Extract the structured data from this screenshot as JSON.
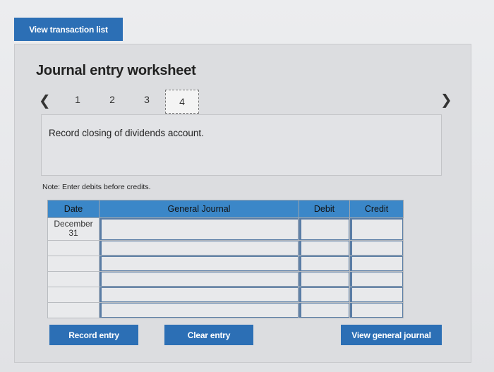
{
  "top": {
    "view_transaction_label": "View transaction list"
  },
  "worksheet": {
    "title": "Journal entry worksheet",
    "nav": {
      "prev_icon": "chevron-left-icon",
      "next_icon": "chevron-right-icon",
      "pages": [
        "1",
        "2",
        "3",
        "4"
      ],
      "active_page": "4"
    },
    "description": "Record closing of dividends account.",
    "note": "Note: Enter debits before credits."
  },
  "table": {
    "headers": {
      "date": "Date",
      "journal": "General Journal",
      "debit": "Debit",
      "credit": "Credit"
    },
    "first_date": "December\n31",
    "first_date_month": "December",
    "first_date_day": "31",
    "rows": 6
  },
  "actions": {
    "record_label": "Record entry",
    "clear_label": "Clear entry",
    "view_journal_label": "View general journal"
  },
  "colors": {
    "button_blue": "#2c6fb5",
    "header_blue": "#3b87c8",
    "input_border": "#5a7da5"
  }
}
